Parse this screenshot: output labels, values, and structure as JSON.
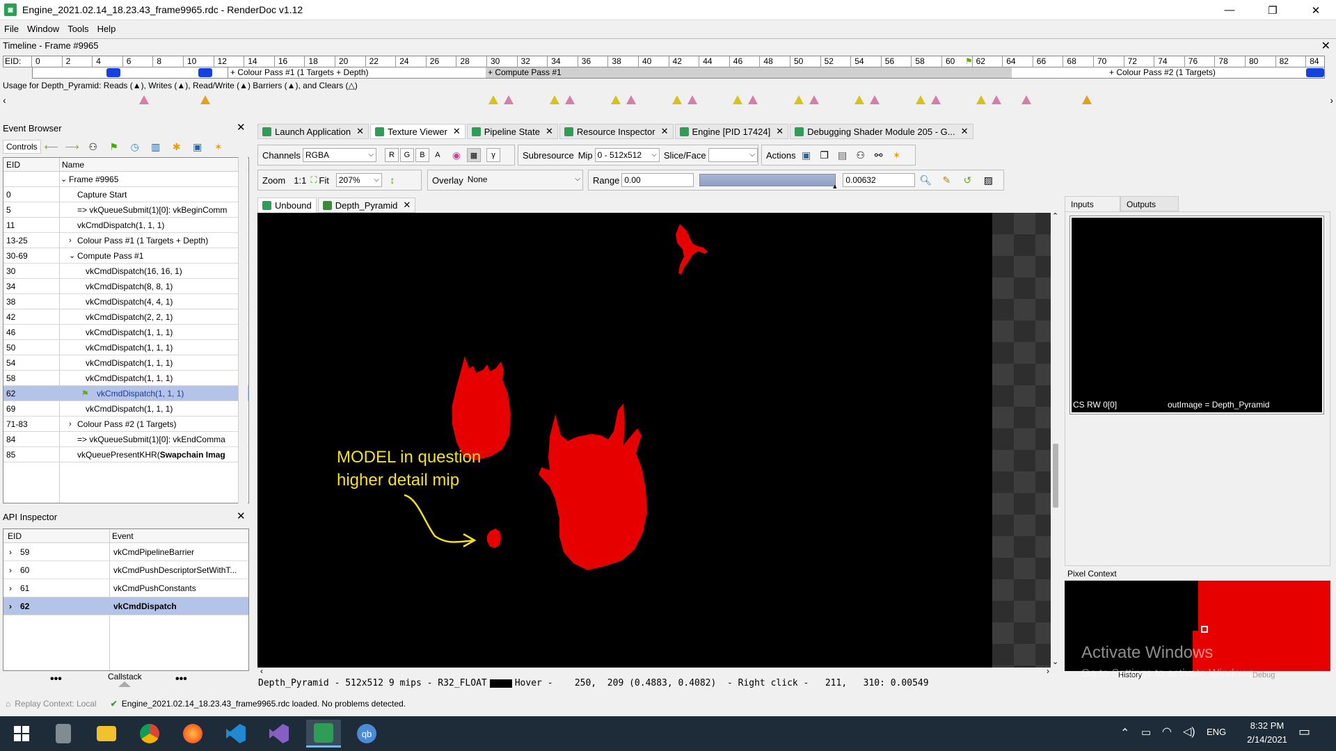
{
  "window": {
    "title": "Engine_2021.02.14_18.23.43_frame9965.rdc - RenderDoc v1.12",
    "min": "—",
    "max": "❐",
    "close": "✕"
  },
  "menu": [
    "File",
    "Window",
    "Tools",
    "Help"
  ],
  "timeline": {
    "header": "Timeline - Frame #9965",
    "eid_label": "EID:",
    "ticks": [
      "0",
      "2",
      "4",
      "6",
      "8",
      "10",
      "12",
      "14",
      "16",
      "18",
      "20",
      "22",
      "24",
      "26",
      "28",
      "30",
      "32",
      "34",
      "36",
      "38",
      "40",
      "42",
      "44",
      "46",
      "48",
      "50",
      "52",
      "54",
      "56",
      "58",
      "60",
      "62",
      "64",
      "66",
      "68",
      "70",
      "72",
      "74",
      "76",
      "78",
      "80",
      "82",
      "84"
    ],
    "passes": [
      "+ Colour Pass #1 (1 Targets + Depth)",
      "+ Compute Pass #1",
      "+ Colour Pass #2 (1 Targets)"
    ],
    "usage": "Usage for Depth_Pyramid: Reads (▲), Writes (▲), Read/Write (▲) Barriers (▲), and Clears (△)"
  },
  "event_browser": {
    "title": "Event Browser",
    "controls_label": "Controls",
    "col_eid": "EID",
    "col_name": "Name",
    "rows": [
      {
        "eid": "",
        "name": "Frame #9965",
        "indent": 1,
        "expander": "v"
      },
      {
        "eid": "0",
        "name": "Capture Start",
        "indent": 2,
        "expander": ""
      },
      {
        "eid": "5",
        "name": "=> vkQueueSubmit(1)[0]: vkBeginComm",
        "indent": 2,
        "expander": ""
      },
      {
        "eid": "11",
        "name": "vkCmdDispatch(1, 1, 1)",
        "indent": 2,
        "expander": ""
      },
      {
        "eid": "13-25",
        "name": "Colour Pass #1 (1 Targets + Depth)",
        "indent": 2,
        "expander": ">"
      },
      {
        "eid": "30-69",
        "name": "Compute Pass #1",
        "indent": 2,
        "expander": "v"
      },
      {
        "eid": "30",
        "name": "vkCmdDispatch(16, 16, 1)",
        "indent": 3,
        "expander": ""
      },
      {
        "eid": "34",
        "name": "vkCmdDispatch(8, 8, 1)",
        "indent": 3,
        "expander": ""
      },
      {
        "eid": "38",
        "name": "vkCmdDispatch(4, 4, 1)",
        "indent": 3,
        "expander": ""
      },
      {
        "eid": "42",
        "name": "vkCmdDispatch(2, 2, 1)",
        "indent": 3,
        "expander": ""
      },
      {
        "eid": "46",
        "name": "vkCmdDispatch(1, 1, 1)",
        "indent": 3,
        "expander": ""
      },
      {
        "eid": "50",
        "name": "vkCmdDispatch(1, 1, 1)",
        "indent": 3,
        "expander": ""
      },
      {
        "eid": "54",
        "name": "vkCmdDispatch(1, 1, 1)",
        "indent": 3,
        "expander": ""
      },
      {
        "eid": "58",
        "name": "vkCmdDispatch(1, 1, 1)",
        "indent": 3,
        "expander": ""
      },
      {
        "eid": "62",
        "name": "vkCmdDispatch(1, 1, 1)",
        "indent": 3,
        "expander": "",
        "selected": true
      },
      {
        "eid": "69",
        "name": "vkCmdDispatch(1, 1, 1)",
        "indent": 3,
        "expander": ""
      },
      {
        "eid": "71-83",
        "name": "Colour Pass #2 (1 Targets)",
        "indent": 2,
        "expander": ">"
      },
      {
        "eid": "84",
        "name": "=> vkQueueSubmit(1)[0]: vkEndComma",
        "indent": 2,
        "expander": ""
      },
      {
        "eid": "85",
        "name": "vkQueuePresentKHR(",
        "bold_tail": "Swapchain Imag",
        "indent": 2,
        "expander": ""
      }
    ]
  },
  "api_inspector": {
    "title": "API Inspector",
    "col_eid": "EID",
    "col_event": "Event",
    "rows": [
      {
        "eid": "59",
        "event": "vkCmdPipelineBarrier"
      },
      {
        "eid": "60",
        "event": "vkCmdPushDescriptorSetWithT..."
      },
      {
        "eid": "61",
        "event": "vkCmdPushConstants"
      },
      {
        "eid": "62",
        "event": "vkCmdDispatch",
        "selected": true
      }
    ],
    "callstack": "Callstack",
    "dots": "•••"
  },
  "doc_tabs": [
    "Launch Application",
    "Texture Viewer",
    "Pipeline State",
    "Resource Inspector",
    "Engine [PID 17424]",
    "Debugging Shader Module 205 - G..."
  ],
  "texture_viewer": {
    "channels_label": "Channels",
    "channels_value": "RGBA",
    "rgba_btns": [
      "R",
      "G",
      "B"
    ],
    "alpha_btn": "A",
    "gamma_btn": "γ",
    "subresource_label": "Subresource",
    "mip_label": "Mip",
    "mip_value": "0 - 512x512",
    "slice_label": "Slice/Face",
    "actions_label": "Actions",
    "zoom_label": "Zoom",
    "zoom_11": "1:1",
    "fit_label": "Fit",
    "zoom_value": "207%",
    "overlay_label": "Overlay",
    "overlay_value": "None",
    "range_label": "Range",
    "range_min": "0.00",
    "range_max": "0.00632",
    "tabs": [
      "Unbound",
      "Depth_Pyramid"
    ],
    "annotation_line1": "MODEL in question",
    "annotation_line2": "higher detail mip",
    "status_name": "Depth_Pyramid - 512x512 9 mips - R32_FLOAT",
    "status_hover": "Hover -    250,  209 (0.4883, 0.4082)  - Right click -   211,   310: 0.00549"
  },
  "inputs_outputs": {
    "tabs": [
      "Inputs",
      "Outputs"
    ],
    "caption_left": "CS RW 0[0]",
    "caption_right": "outImage = Depth_Pyramid"
  },
  "pixel_context": {
    "title": "Pixel Context",
    "history": "History",
    "debug": "Debug"
  },
  "watermark": {
    "line1": "Activate Windows",
    "line2": "Go to Settings to activate Windows."
  },
  "status_bar": {
    "replay": "Replay Context: Local",
    "message": "Engine_2021.02.14_18.23.43_frame9965.rdc loaded. No problems detected."
  },
  "taskbar": {
    "lang": "ENG",
    "time": "8:32 PM",
    "date": "2/14/2021"
  },
  "colors": {
    "selection": "#b4c3e8",
    "marker_blue": "#1640e0",
    "read_yellow": "#d6c21e",
    "write_pink": "#d47fa8",
    "model_red": "#e00000",
    "annotation_yellow": "#f5e020"
  }
}
